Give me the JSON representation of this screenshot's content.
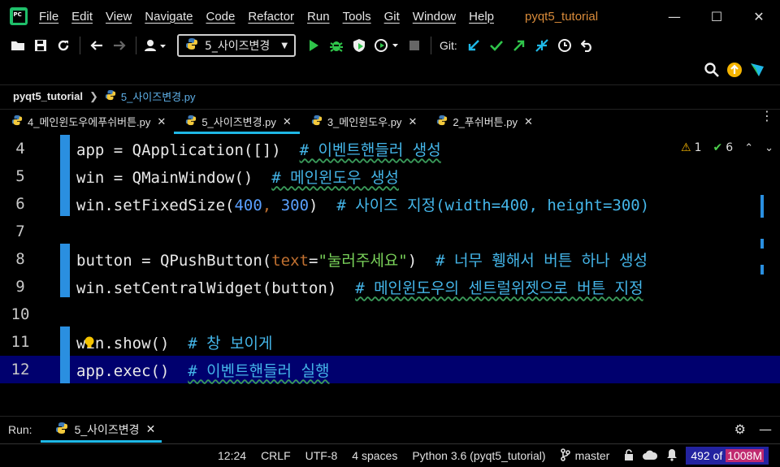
{
  "menubar": {
    "items": [
      "File",
      "Edit",
      "View",
      "Navigate",
      "Code",
      "Refactor",
      "Run",
      "Tools",
      "Git",
      "Window",
      "Help"
    ],
    "window_title": "pyqt5_tutorial"
  },
  "toolbar": {
    "run_config": "5_사이즈변경",
    "git_label": "Git:"
  },
  "breadcrumb": {
    "project": "pyqt5_tutorial",
    "file": "5_사이즈변경.py"
  },
  "tabs": [
    {
      "label": "4_메인윈도우에푸쉬버튼.py",
      "active": false
    },
    {
      "label": "5_사이즈변경.py",
      "active": true
    },
    {
      "label": "3_메인윈도우.py",
      "active": false
    },
    {
      "label": "2_푸쉬버튼.py",
      "active": false
    }
  ],
  "inspections": {
    "warnings": "1",
    "typos": "6"
  },
  "code_lines": [
    {
      "num": "4",
      "code": "app = QApplication([])",
      "comment": "# 이벤트핸들러 생성"
    },
    {
      "num": "5",
      "code": "win = QMainWindow()",
      "comment": "# 메인윈도우 생성"
    },
    {
      "num": "6",
      "code_pre": "win.setFixedSize(",
      "n1": "400",
      "sep": ", ",
      "n2": "300",
      "code_post": ")",
      "comment": "# 사이즈 지정(width=400, height=300)"
    },
    {
      "num": "7"
    },
    {
      "num": "8",
      "code_pre": "button = QPushButton(",
      "kw": "text",
      "eq": "=",
      "str": "\"눌러주세요\"",
      "code_post": ")",
      "comment": "# 너무 휑해서 버튼 하나 생성"
    },
    {
      "num": "9",
      "code": "win.setCentralWidget(button)",
      "comment": "# 메인윈도우의 센트럴위젯으로 버튼 지정"
    },
    {
      "num": "10"
    },
    {
      "num": "11",
      "code": "win.show()",
      "comment": "# 창 보이게"
    },
    {
      "num": "12",
      "code": "app.exec()",
      "comment": "# 이벤트핸들러 실행"
    }
  ],
  "run_panel": {
    "label": "Run:",
    "tab": "5_사이즈변경"
  },
  "status": {
    "position": "12:24",
    "line_sep": "CRLF",
    "encoding": "UTF-8",
    "indent": "4 spaces",
    "interpreter": "Python 3.6 (pyqt5_tutorial)",
    "branch": "master",
    "mem_used": "492 of ",
    "mem_total": "1008M"
  },
  "colors": {
    "accent": "#1fb8e6",
    "current_line": "#00006e",
    "comment": "#44b5e8",
    "gutter_mark": "#2a8fe0"
  }
}
